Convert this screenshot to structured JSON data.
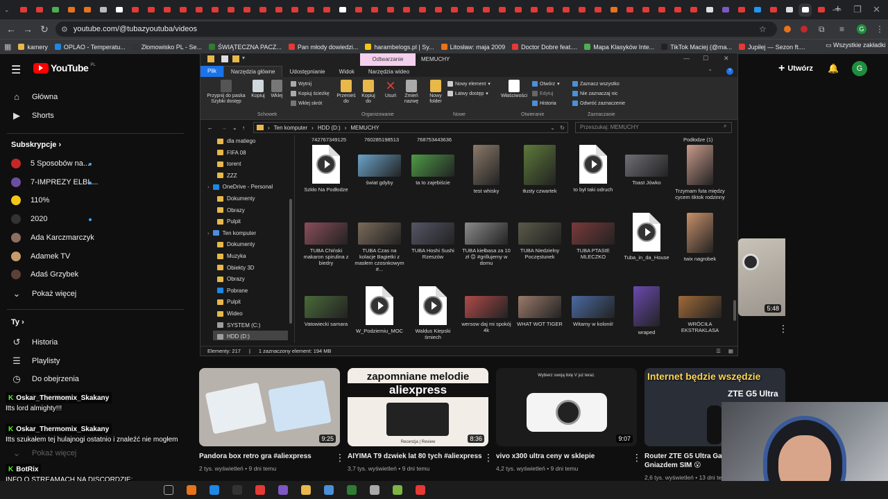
{
  "browser": {
    "url": "youtube.com/@tubazyoutuba/videos",
    "new_tab": "+",
    "bookmarks": [
      "kamery",
      "OPLAO - Temperatu...",
      "Złomowisko PL - Se...",
      "ŚWIĄTECZNA PACZ...",
      "Pan młody dowiedzi...",
      "harambelogs.pl | Sy...",
      "Litosław: maja 2009",
      "Doctor Dobre feat....",
      "Mapa Klasyków Inte...",
      "TikTok Maciej (@ma...",
      "Jupiłej — Sezon ft...."
    ],
    "all_bookmarks": "Wszystkie zakładki"
  },
  "youtube": {
    "logo_text": "YouTube",
    "logo_sup": "PL",
    "create_label": "Utwórz",
    "avatar_letter": "G",
    "nav": [
      {
        "label": "Główna",
        "icon": "home-icon"
      },
      {
        "label": "Shorts",
        "icon": "shorts-icon"
      }
    ],
    "subs_heading": "Subskrypcje",
    "subscriptions": [
      {
        "name": "5 Sposobów na...",
        "color": "#c62828",
        "dot": true
      },
      {
        "name": "7-IMPREZY ELBL...",
        "color": "#6a4fa0",
        "dot": true
      },
      {
        "name": "110%",
        "color": "#f5c518",
        "dot": false
      },
      {
        "name": "2020",
        "color": "#333333",
        "dot": true
      },
      {
        "name": "Ada Karczmarczyk",
        "color": "#8d6e63",
        "dot": false
      },
      {
        "name": "Adamek TV",
        "color": "#c69c6d",
        "dot": false
      },
      {
        "name": "Adaś Grzybek",
        "color": "#5d4037",
        "dot": false
      }
    ],
    "show_more": "Pokaż więcej",
    "you_heading": "Ty",
    "you_items": [
      {
        "label": "Historia",
        "icon": "history-icon"
      },
      {
        "label": "Playlisty",
        "icon": "playlist-icon"
      },
      {
        "label": "Do obejrzenia",
        "icon": "clock-icon"
      },
      {
        "label": "Twoje filmy",
        "icon": "video-icon"
      }
    ],
    "show_more2": "Pokaż więcej",
    "videos": [
      {
        "title": "Pandora box retro gra #aliexpress",
        "views": "2 tys. wyświetleń",
        "age": "9 dni temu",
        "duration": "9:25",
        "thumb": "#b8b2ac"
      },
      {
        "title": "AIYIMA T9 dzwiek lat 80 tych #aliexpress",
        "views": "3,7 tys. wyświetleń",
        "age": "9 dni temu",
        "duration": "8:36",
        "thumb": "#f2ede6",
        "overlay": "zapomniane melodie",
        "overlay2": "aliexpress",
        "overlay3": "Recenzja | Review"
      },
      {
        "title": "vivo x300 ultra ceny w sklepie",
        "views": "4,2 tys. wyświetleń",
        "age": "9 dni temu",
        "duration": "9:07",
        "thumb": "#1b1b1b",
        "overlay": "Wybierz swoją listę V już teraz."
      },
      {
        "title": "Router ZTE G5 Ultra Gaming",
        "views": "2,6 tys. wyświetleń",
        "age": "13 dni temu",
        "duration": "",
        "thumb": "#2a2e36",
        "overlay": "Internet będzie wszędzie",
        "overlay2": "ZTE G5 Ultra",
        "title_suffix": "Gniazdem SIM 😮"
      }
    ],
    "side_duration": "5:48"
  },
  "chat": [
    {
      "user": "Oskar_Thermomix_Skakany",
      "msg": "Itts lord almighty!!!"
    },
    {
      "user": "Oskar_Thermomix_Skakany",
      "msg": "Itts szukałem tej hulajnogi ostatnio i znaleźć nie mogłem"
    },
    {
      "user": "BotRix",
      "msg": "INFO O STREAMACH NA DISCORDZIE:"
    },
    {
      "user": "",
      "msg": "https://discord.gg/CzgEWfqUfs"
    }
  ],
  "explorer": {
    "context_tab": "Odtwarzanie",
    "window_title": "MEMUCHY",
    "tabs": [
      "Plik",
      "Narzędzia główne",
      "Udostępnianie",
      "Widok",
      "Narzędzia wideo"
    ],
    "ribbon": {
      "pin": "Przypnij do paska Szybki dostęp",
      "copy": "Kopiuj",
      "paste": "Wklej",
      "cut": "Wytnij",
      "copy_path": "Kopiuj ścieżkę",
      "paste_shortcut": "Wklej skrót",
      "group_clipboard": "Schowek",
      "move": "Przenieś do",
      "copyto": "Kopiuj do",
      "delete": "Usuń",
      "rename": "Zmień nazwę",
      "group_organize": "Organizowanie",
      "new_folder": "Nowy folder",
      "new_item": "Nowy element",
      "easy_access": "Łatwy dostęp",
      "group_new": "Nowe",
      "properties": "Właściwości",
      "open": "Otwórz",
      "edit": "Edytuj",
      "history": "Historia",
      "group_open": "Otwieranie",
      "select_all": "Zaznacz wszystko",
      "select_none": "Nie zaznaczaj nic",
      "invert": "Odwróć zaznaczenie",
      "group_select": "Zaznaczanie"
    },
    "path": [
      "Ten komputer",
      "HDD (D:)",
      "MEMUCHY"
    ],
    "search_placeholder": "Przeszukaj: MEMUCHY",
    "nav_items": [
      {
        "label": "dla matiego",
        "type": "folder",
        "indent": 1
      },
      {
        "label": "FIFA 08",
        "type": "folder",
        "indent": 1
      },
      {
        "label": "torent",
        "type": "folder",
        "indent": 1
      },
      {
        "label": "ZZZ",
        "type": "folder",
        "indent": 1
      },
      {
        "label": "OneDrive - Personal",
        "type": "cloud",
        "indent": 0
      },
      {
        "label": "Dokumenty",
        "type": "folder",
        "indent": 1
      },
      {
        "label": "Obrazy",
        "type": "folder",
        "indent": 1
      },
      {
        "label": "Pulpit",
        "type": "folder",
        "indent": 1
      },
      {
        "label": "Ten komputer",
        "type": "pc",
        "indent": 0
      },
      {
        "label": "Dokumenty",
        "type": "folder",
        "indent": 1
      },
      {
        "label": "Muzyka",
        "type": "folder",
        "indent": 1
      },
      {
        "label": "Obiekty 3D",
        "type": "folder",
        "indent": 1
      },
      {
        "label": "Obrazy",
        "type": "folder",
        "indent": 1
      },
      {
        "label": "Pobrane",
        "type": "dl",
        "indent": 1
      },
      {
        "label": "Pulpit",
        "type": "folder",
        "indent": 1
      },
      {
        "label": "Wideo",
        "type": "folder",
        "indent": 1
      },
      {
        "label": "SYSTEM (C:)",
        "type": "drive",
        "indent": 1
      },
      {
        "label": "HDD (D:)",
        "type": "drive",
        "indent": 1
      }
    ],
    "top_numbers": [
      "742767349125",
      "760285198513",
      "768753443636",
      "Podłodze (1)"
    ],
    "files": [
      {
        "name": "Szkło Na Podłodze",
        "kind": "doc",
        "col": 0,
        "row": 0
      },
      {
        "name": "świat gdyby",
        "kind": "thumb",
        "color": "#6ba3c9",
        "col": 1,
        "row": 0
      },
      {
        "name": "ta to zajebiście",
        "kind": "thumb",
        "color": "#4e9a47",
        "col": 2,
        "row": 0
      },
      {
        "name": "test whisky",
        "kind": "tall",
        "color": "#8a7a6a",
        "col": 3,
        "row": 0
      },
      {
        "name": "tłusty czwartek",
        "kind": "sq",
        "color": "#5d7a3a",
        "col": 4,
        "row": 0
      },
      {
        "name": "to był taki odruch",
        "kind": "doc",
        "col": 5,
        "row": 0
      },
      {
        "name": "Toast Jówko",
        "kind": "thumb",
        "color": "#6e6e75",
        "col": 6,
        "row": 0
      },
      {
        "name": "Trzymam futa między cycem tiktok rodzinny",
        "kind": "tall",
        "color": "#c89a8a",
        "col": 7,
        "row": 0
      },
      {
        "name": "TUBA Chiński makaron spirulina z biedry",
        "kind": "thumb",
        "color": "#8a4e5a",
        "col": 0,
        "row": 1
      },
      {
        "name": "TUBA Czas na kolacje Bagietki z masłem czosnkowym #...",
        "kind": "thumb",
        "color": "#7a6a5a",
        "col": 1,
        "row": 1
      },
      {
        "name": "TUBA Hoshi Sushi Rzeszów",
        "kind": "thumb",
        "color": "#555566",
        "col": 2,
        "row": 1
      },
      {
        "name": "TUBA kiełbasa za 10 zł 😊 #grillujemy w domu",
        "kind": "thumb",
        "color": "#8a8a8a",
        "col": 3,
        "row": 1
      },
      {
        "name": "TUBA Niedzielny Poczęstunek",
        "kind": "thumb",
        "color": "#5a5a4a",
        "col": 4,
        "row": 1
      },
      {
        "name": "TUBA PTASIE MLECZKO",
        "kind": "thumb",
        "color": "#7a3a3a",
        "col": 5,
        "row": 1
      },
      {
        "name": "Tuba_in_da_House",
        "kind": "doc",
        "col": 6,
        "row": 1
      },
      {
        "name": "twix nagrobek",
        "kind": "tall",
        "color": "#c8906a",
        "col": 7,
        "row": 1
      },
      {
        "name": "Vatowiecki samara",
        "kind": "thumb",
        "color": "#4a6a3a",
        "col": 0,
        "row": 2
      },
      {
        "name": "W_Podziemiu_MOC",
        "kind": "doc",
        "col": 1,
        "row": 2
      },
      {
        "name": "Waldus Kiepski śmiech",
        "kind": "doc",
        "col": 2,
        "row": 2
      },
      {
        "name": "wersow daj mi spokój 4k",
        "kind": "thumb",
        "color": "#b04a4a",
        "col": 3,
        "row": 2
      },
      {
        "name": "WHAT WOT TIGER",
        "kind": "thumb",
        "color": "#9a7a6a",
        "col": 4,
        "row": 2
      },
      {
        "name": "Witamy w kolonii!",
        "kind": "thumb",
        "color": "#4a6aa0",
        "col": 5,
        "row": 2
      },
      {
        "name": "wraped",
        "kind": "tall",
        "color": "#6a4ab0",
        "col": 6,
        "row": 2
      },
      {
        "name": "WRÓCIŁA EKSTRAKLASA",
        "kind": "thumb",
        "color": "#a06a3a",
        "col": 7,
        "row": 2
      }
    ],
    "status_items": "Elementy: 217",
    "status_selected": "1 zaznaczony element: 194 MB"
  }
}
